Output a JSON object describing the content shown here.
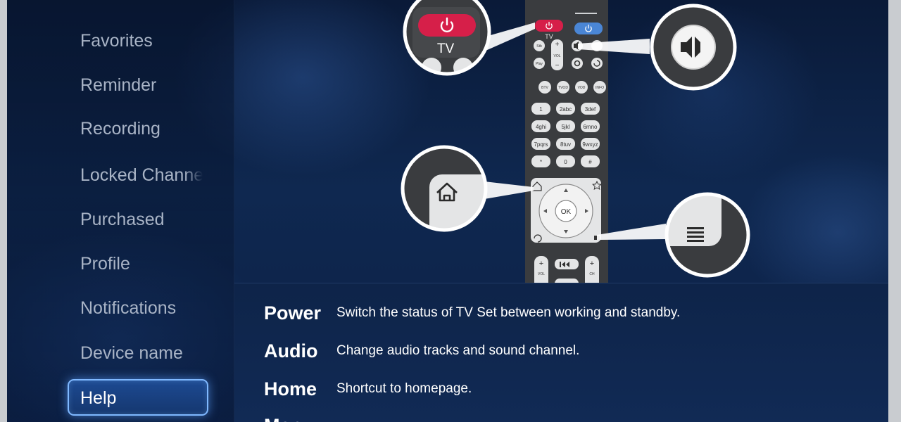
{
  "sidebar": {
    "items": [
      {
        "label": "Favorites"
      },
      {
        "label": "Reminder"
      },
      {
        "label": "Recording"
      },
      {
        "label": "Locked Channels"
      },
      {
        "label": "Purchased"
      },
      {
        "label": "Profile"
      },
      {
        "label": "Notifications"
      },
      {
        "label": "Device name"
      },
      {
        "label": "Help",
        "selected": true
      }
    ]
  },
  "remote": {
    "tv_label": "TV",
    "callout_tv_label": "TV",
    "vol_label": "VOL",
    "ch_label": "CH",
    "ok_label": "OK",
    "top_keys": [
      "Stb",
      "Play"
    ],
    "function_keys": [
      "BTV",
      "TVOD",
      "VOD",
      "INFO"
    ],
    "number_keys": [
      [
        "1",
        "2abc",
        "3def"
      ],
      [
        "4ghi",
        "5jkl",
        "6mno"
      ],
      [
        "7pqrs",
        "8tuv",
        "9wxyz"
      ],
      [
        "*",
        "0",
        "#"
      ]
    ],
    "icons": [
      "power-icon",
      "mute-icon",
      "home-icon",
      "menu-icon",
      "back-icon",
      "star-icon",
      "settings-icon",
      "refresh-icon",
      "rewind-icon"
    ]
  },
  "help": {
    "entries": [
      {
        "key": "Power",
        "description": "Switch the status of TV Set between working and standby."
      },
      {
        "key": "Audio",
        "description": "Change audio tracks and sound channel."
      },
      {
        "key": "Home",
        "description": "Shortcut to homepage."
      },
      {
        "key": "Menu",
        "description": ""
      }
    ]
  },
  "colors": {
    "accent": "#7fb8ff",
    "power_red": "#d61f49",
    "stb_blue": "#4a86d6",
    "remote_body": "#3a3c3f"
  }
}
